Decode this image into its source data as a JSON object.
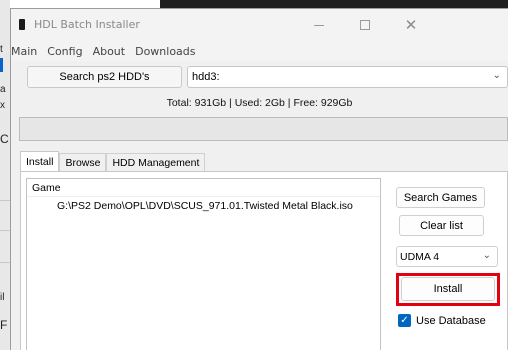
{
  "window": {
    "title": "HDL Batch Installer"
  },
  "menu": [
    "Main",
    "Config",
    "About",
    "Downloads"
  ],
  "toolbar": {
    "search_label": "Search ps2 HDD's",
    "hdd_value": "hdd3:"
  },
  "status": {
    "totals": "Total: 931Gb | Used: 2Gb | Free: 929Gb"
  },
  "progress": {
    "fraction": 0.0
  },
  "tabs": [
    {
      "label": "Install",
      "active": true
    },
    {
      "label": "Browse",
      "active": false
    },
    {
      "label": "HDD Management",
      "active": false
    }
  ],
  "install": {
    "list_header": "Game",
    "files": [
      "G:\\PS2 Demo\\OPL\\DVD\\SCUS_971.01.Twisted Metal Black.iso"
    ],
    "search_games_label": "Search Games",
    "clear_list_label": "Clear list",
    "udma_value": "UDMA 4",
    "install_label": "Install",
    "use_database_label": "Use Database",
    "use_database_checked": true
  },
  "colors": {
    "highlight": "#e3000f",
    "checkbox": "#0067c0"
  },
  "background_window": {
    "fragments": [
      "t",
      "a",
      "x",
      "C",
      "il",
      "F"
    ]
  }
}
